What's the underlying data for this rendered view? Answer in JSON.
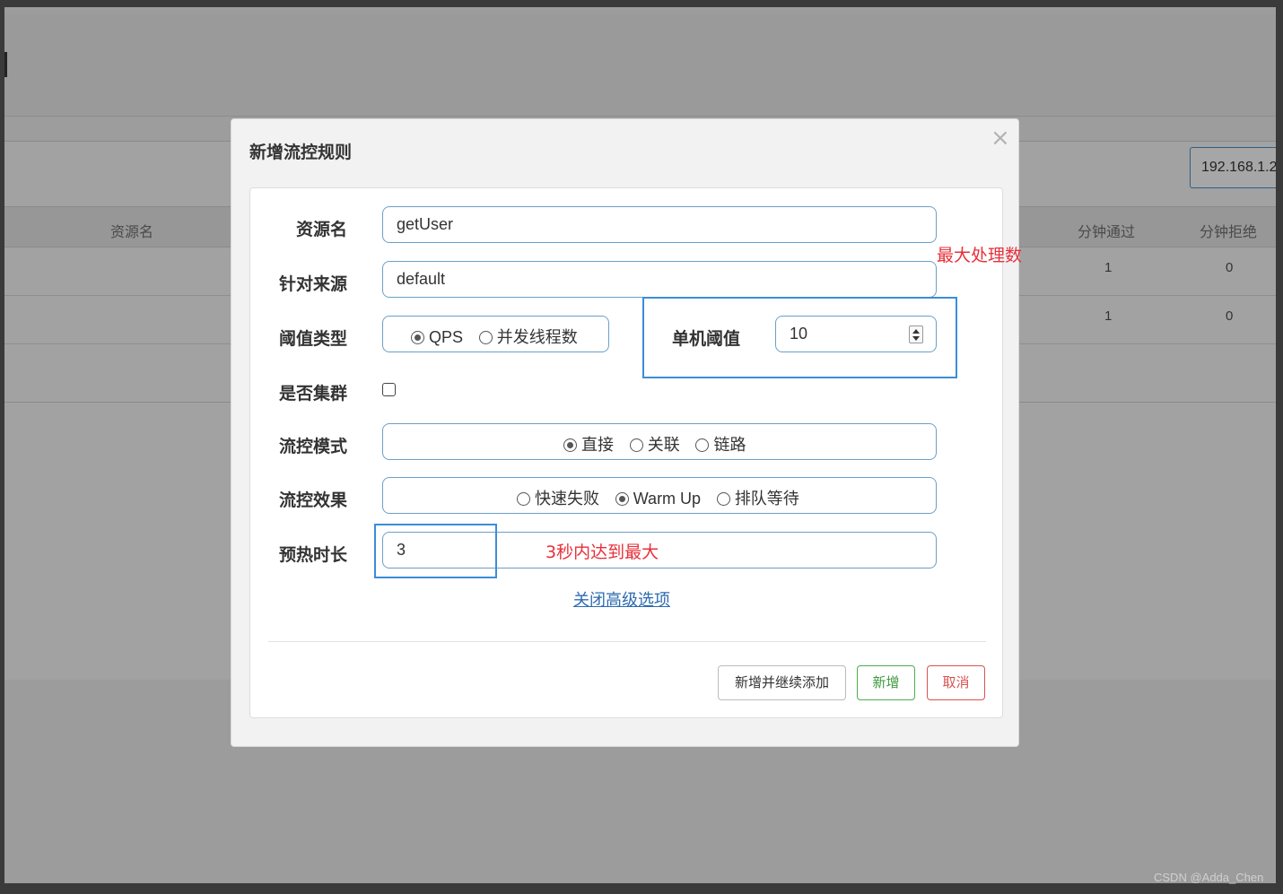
{
  "background": {
    "ip_input_value": "192.168.1.2",
    "table_headers": {
      "resource_name": "资源名",
      "minute_pass": "分钟通过",
      "minute_reject": "分钟拒绝"
    },
    "rows": [
      {
        "pass": "1",
        "reject": "0"
      },
      {
        "pass": "1",
        "reject": "0"
      }
    ]
  },
  "modal": {
    "title": "新增流控规则",
    "close_glyph": "×",
    "fields": {
      "resource": {
        "label": "资源名",
        "value": "getUser"
      },
      "origin": {
        "label": "针对来源",
        "value": "default"
      },
      "threshold_type": {
        "label": "阈值类型",
        "options": [
          {
            "label": "QPS",
            "selected": true
          },
          {
            "label": "并发线程数",
            "selected": false
          }
        ]
      },
      "threshold": {
        "label": "单机阈值",
        "value": "10"
      },
      "cluster": {
        "label": "是否集群",
        "checked": false
      },
      "control_mode": {
        "label": "流控模式",
        "options": [
          {
            "label": "直接",
            "selected": true
          },
          {
            "label": "关联",
            "selected": false
          },
          {
            "label": "链路",
            "selected": false
          }
        ]
      },
      "control_effect": {
        "label": "流控效果",
        "options": [
          {
            "label": "快速失败",
            "selected": false
          },
          {
            "label": "Warm Up",
            "selected": true
          },
          {
            "label": "排队等待",
            "selected": false
          }
        ]
      },
      "warmup": {
        "label": "预热时长",
        "value": "3"
      }
    },
    "advanced_link": "关闭高级选项",
    "buttons": {
      "add_continue": "新增并继续添加",
      "add": "新增",
      "cancel": "取消"
    }
  },
  "annotations": {
    "max_processing": "最大处理数",
    "warmup_note": "3秒内达到最大",
    "color": "#e8303a",
    "box_color": "#3c8dd8"
  },
  "watermark": "CSDN @Adda_Chen"
}
